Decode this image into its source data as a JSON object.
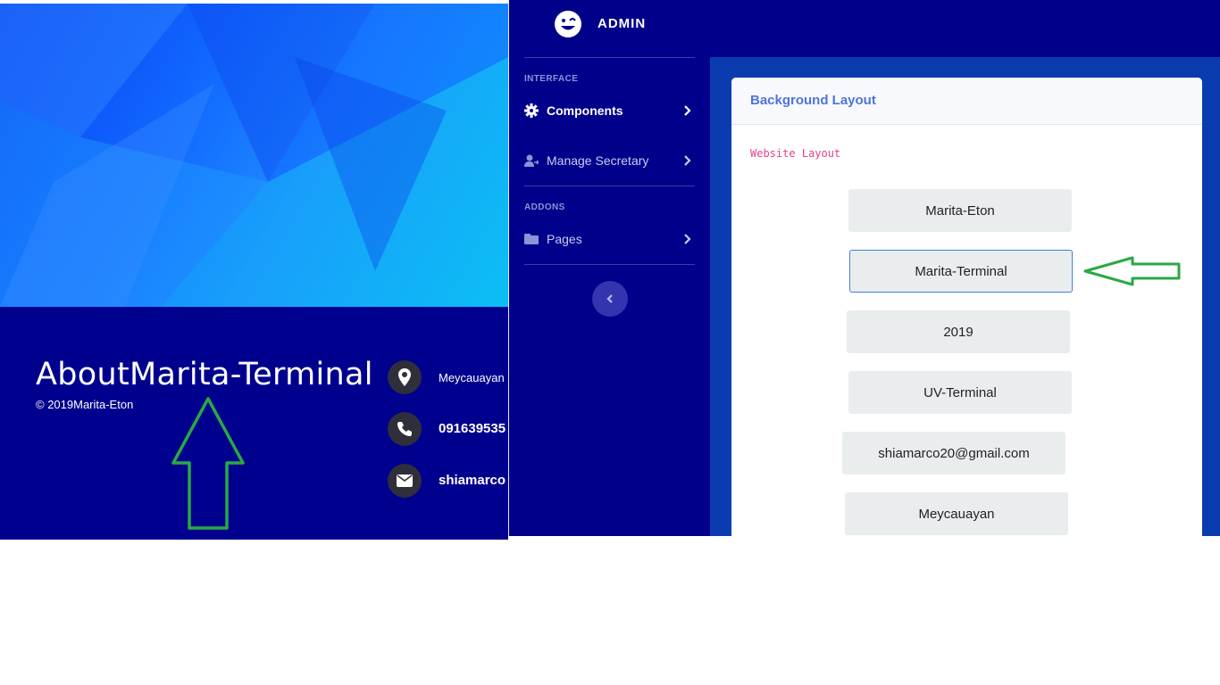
{
  "left_panel": {
    "about_title": "AboutMarita-Terminal",
    "copyright": "© 2019Marita-Eton",
    "contacts": [
      {
        "icon": "map-marker-icon",
        "text": "Meycauayan"
      },
      {
        "icon": "phone-icon",
        "text": "091639535"
      },
      {
        "icon": "envelope-icon",
        "text": "shiamarco"
      }
    ]
  },
  "admin": {
    "brand": "ADMIN",
    "sidebar": {
      "heading_interface": "INTERFACE",
      "items": [
        {
          "label": "Components",
          "icon": "cog-icon",
          "active": true
        },
        {
          "label": "Manage Secretary",
          "icon": "user-icon",
          "active": false
        }
      ],
      "heading_addons": "ADDONS",
      "addon_items": [
        {
          "label": "Pages",
          "icon": "folder-icon"
        }
      ]
    },
    "card": {
      "title": "Background Layout",
      "code_label": "Website Layout",
      "buttons": [
        "Marita-Eton",
        "Marita-Terminal",
        "2019",
        "UV-Terminal",
        "shiamarco20@gmail.com",
        "Meycauayan"
      ]
    }
  },
  "colors": {
    "navy": "#00008b",
    "content_blue": "#0a3cb0",
    "card_title": "#4e73df",
    "code_pink": "#e83e8c",
    "arrow_green": "#28a745"
  }
}
